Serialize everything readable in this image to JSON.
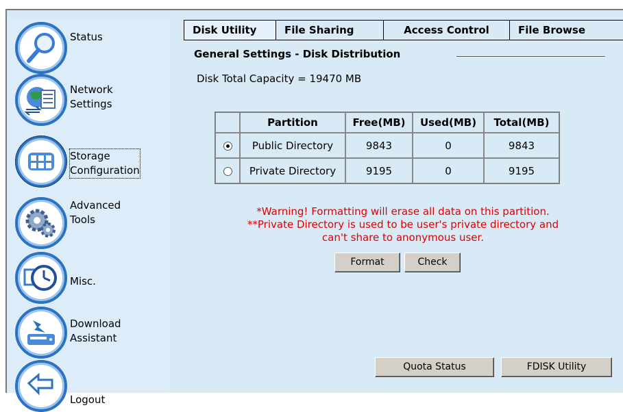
{
  "sidebar": {
    "items": [
      {
        "label": "Status",
        "icon": "magnifier-icon"
      },
      {
        "label": "Network\nSettings",
        "icon": "network-icon"
      },
      {
        "label": "Storage\nConfiguration",
        "icon": "storage-grid-icon"
      },
      {
        "label": "Advanced\nTools",
        "icon": "gears-icon"
      },
      {
        "label": "Misc.",
        "icon": "clock-icon"
      },
      {
        "label": "Download\nAssistant",
        "icon": "download-icon"
      },
      {
        "label": "Logout",
        "icon": "back-arrow-icon"
      }
    ]
  },
  "tabs": [
    "Disk Utility",
    "File Sharing",
    "Access Control",
    "File Browse"
  ],
  "main": {
    "section_title": "General Settings - Disk Distribution",
    "capacity": "Disk Total Capacity = 19470 MB",
    "table": {
      "headers": [
        "Partition",
        "Free(MB)",
        "Used(MB)",
        "Total(MB)"
      ],
      "rows": [
        {
          "selected": true,
          "partition": "Public Directory",
          "free": "9843",
          "used": "0",
          "total": "9843"
        },
        {
          "selected": false,
          "partition": "Private Directory",
          "free": "9195",
          "used": "0",
          "total": "9195"
        }
      ]
    },
    "warning1": "*Warning! Formatting will erase all data on this partition.",
    "warning2": "**Private Directory is used to be user's private directory and",
    "warning3": "can't share to anonymous user.",
    "format_label": "Format",
    "check_label": "Check",
    "quota_label": "Quota Status",
    "fdisk_label": "FDISK Utility"
  },
  "colors": {
    "background": "#d9eaf7",
    "warning": "#e00000",
    "nav_ring": "#2b72c2"
  }
}
